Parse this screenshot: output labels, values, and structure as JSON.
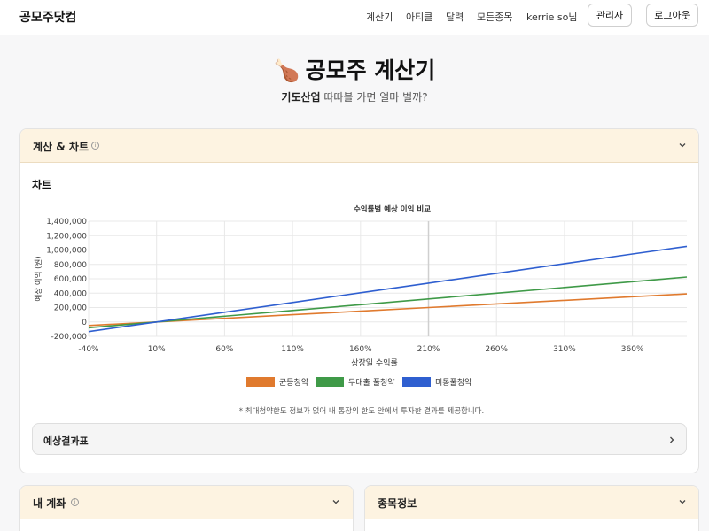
{
  "topbar": {
    "brand": "공모주닷컴",
    "nav": [
      "계산기",
      "아티클",
      "달력",
      "모든종목"
    ],
    "user": "kerrie so님",
    "admin_button": "관리자",
    "logout_button": "로그아웃"
  },
  "hero": {
    "title": "공모주 계산기",
    "company": "기도산업",
    "subtitle_rest": " 따따블 가면 얼마 벌까?"
  },
  "calc_card": {
    "title": "계산 & 차트",
    "chart_section_label": "차트",
    "note": "* 최대청약한도 정보가 없어 내 통장의 한도 안에서 투자한 결과를 제공합니다.",
    "results_label": "예상결과표"
  },
  "account_card": {
    "title": "내 계좌"
  },
  "info_card": {
    "title": "종목정보"
  },
  "chart_data": {
    "type": "line",
    "title": "수익률별 예상 이익 비교",
    "xlabel": "상장일 수익률",
    "ylabel": "예상 이익 (원)",
    "x": [
      -40,
      10,
      60,
      110,
      160,
      210,
      260,
      310,
      360,
      400
    ],
    "x_ticks": [
      "-40%",
      "10%",
      "60%",
      "110%",
      "160%",
      "210%",
      "260%",
      "310%",
      "360%"
    ],
    "y_ticks": [
      "1,400,000",
      "1,200,000",
      "1,000,000",
      "800,000",
      "600,000",
      "400,000",
      "200,000",
      "0",
      "-200,000"
    ],
    "ylim": [
      -200000,
      1400000
    ],
    "xlim": [
      -40,
      400
    ],
    "grid": true,
    "legend": "bottom",
    "series": [
      {
        "name": "균등청약",
        "color": "#e07a2e",
        "values": [
          -50000,
          0,
          50000,
          100000,
          150000,
          200000,
          250000,
          300000,
          350000,
          390000
        ]
      },
      {
        "name": "무대출 풀청약",
        "color": "#3f9a48",
        "values": [
          -80000,
          0,
          80000,
          160000,
          240000,
          320000,
          400000,
          480000,
          560000,
          625000
        ]
      },
      {
        "name": "미통풀청약",
        "color": "#2f5fd0",
        "values": [
          -135000,
          0,
          135000,
          270000,
          405000,
          540000,
          675000,
          810000,
          945000,
          1050000
        ]
      }
    ]
  }
}
